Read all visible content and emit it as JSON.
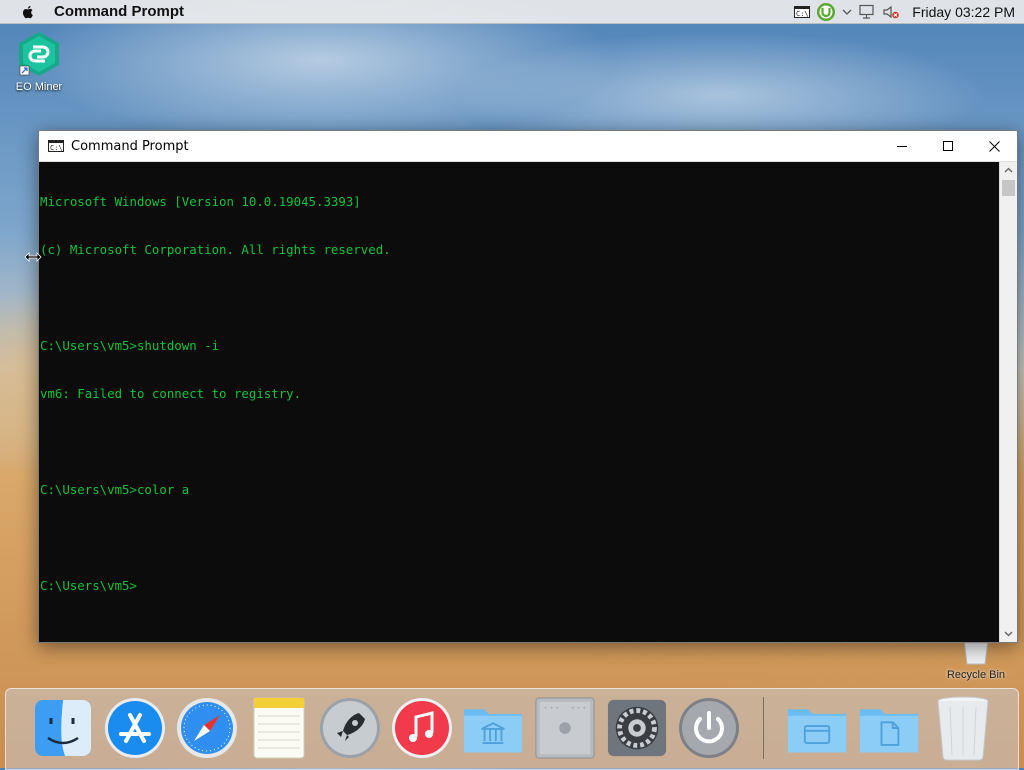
{
  "menubar": {
    "app_name": "Command Prompt",
    "clock": "Friday 03:22 PM",
    "tray_icons": [
      "console-icon",
      "torrent-icon",
      "chevron-down-icon",
      "network-icon",
      "volume-muted-icon"
    ]
  },
  "desktop": {
    "icons": [
      {
        "label": "EO Miner",
        "icon": "eo-miner-icon"
      },
      {
        "label": "Recycle Bin",
        "icon": "recycle-bin-icon"
      }
    ]
  },
  "window": {
    "title": "Command Prompt",
    "controls": [
      "minimize",
      "maximize",
      "close"
    ],
    "text_color": "#13c13a",
    "background_color": "#0c0c0c",
    "lines": [
      "Microsoft Windows [Version 10.0.19045.3393]",
      "(c) Microsoft Corporation. All rights reserved.",
      "",
      "C:\\Users\\vm5>shutdown -i",
      "vm6: Failed to connect to registry.",
      "",
      "C:\\Users\\vm5>color a",
      "",
      "C:\\Users\\vm5>"
    ]
  },
  "dock": {
    "items": [
      "finder-icon",
      "app-store-icon",
      "safari-icon",
      "notes-icon",
      "launchpad-icon",
      "music-icon",
      "applications-folder-icon",
      "mac-pro-icon",
      "system-preferences-icon",
      "power-icon",
      "folder-icon",
      "documents-folder-icon",
      "trash-icon"
    ]
  }
}
